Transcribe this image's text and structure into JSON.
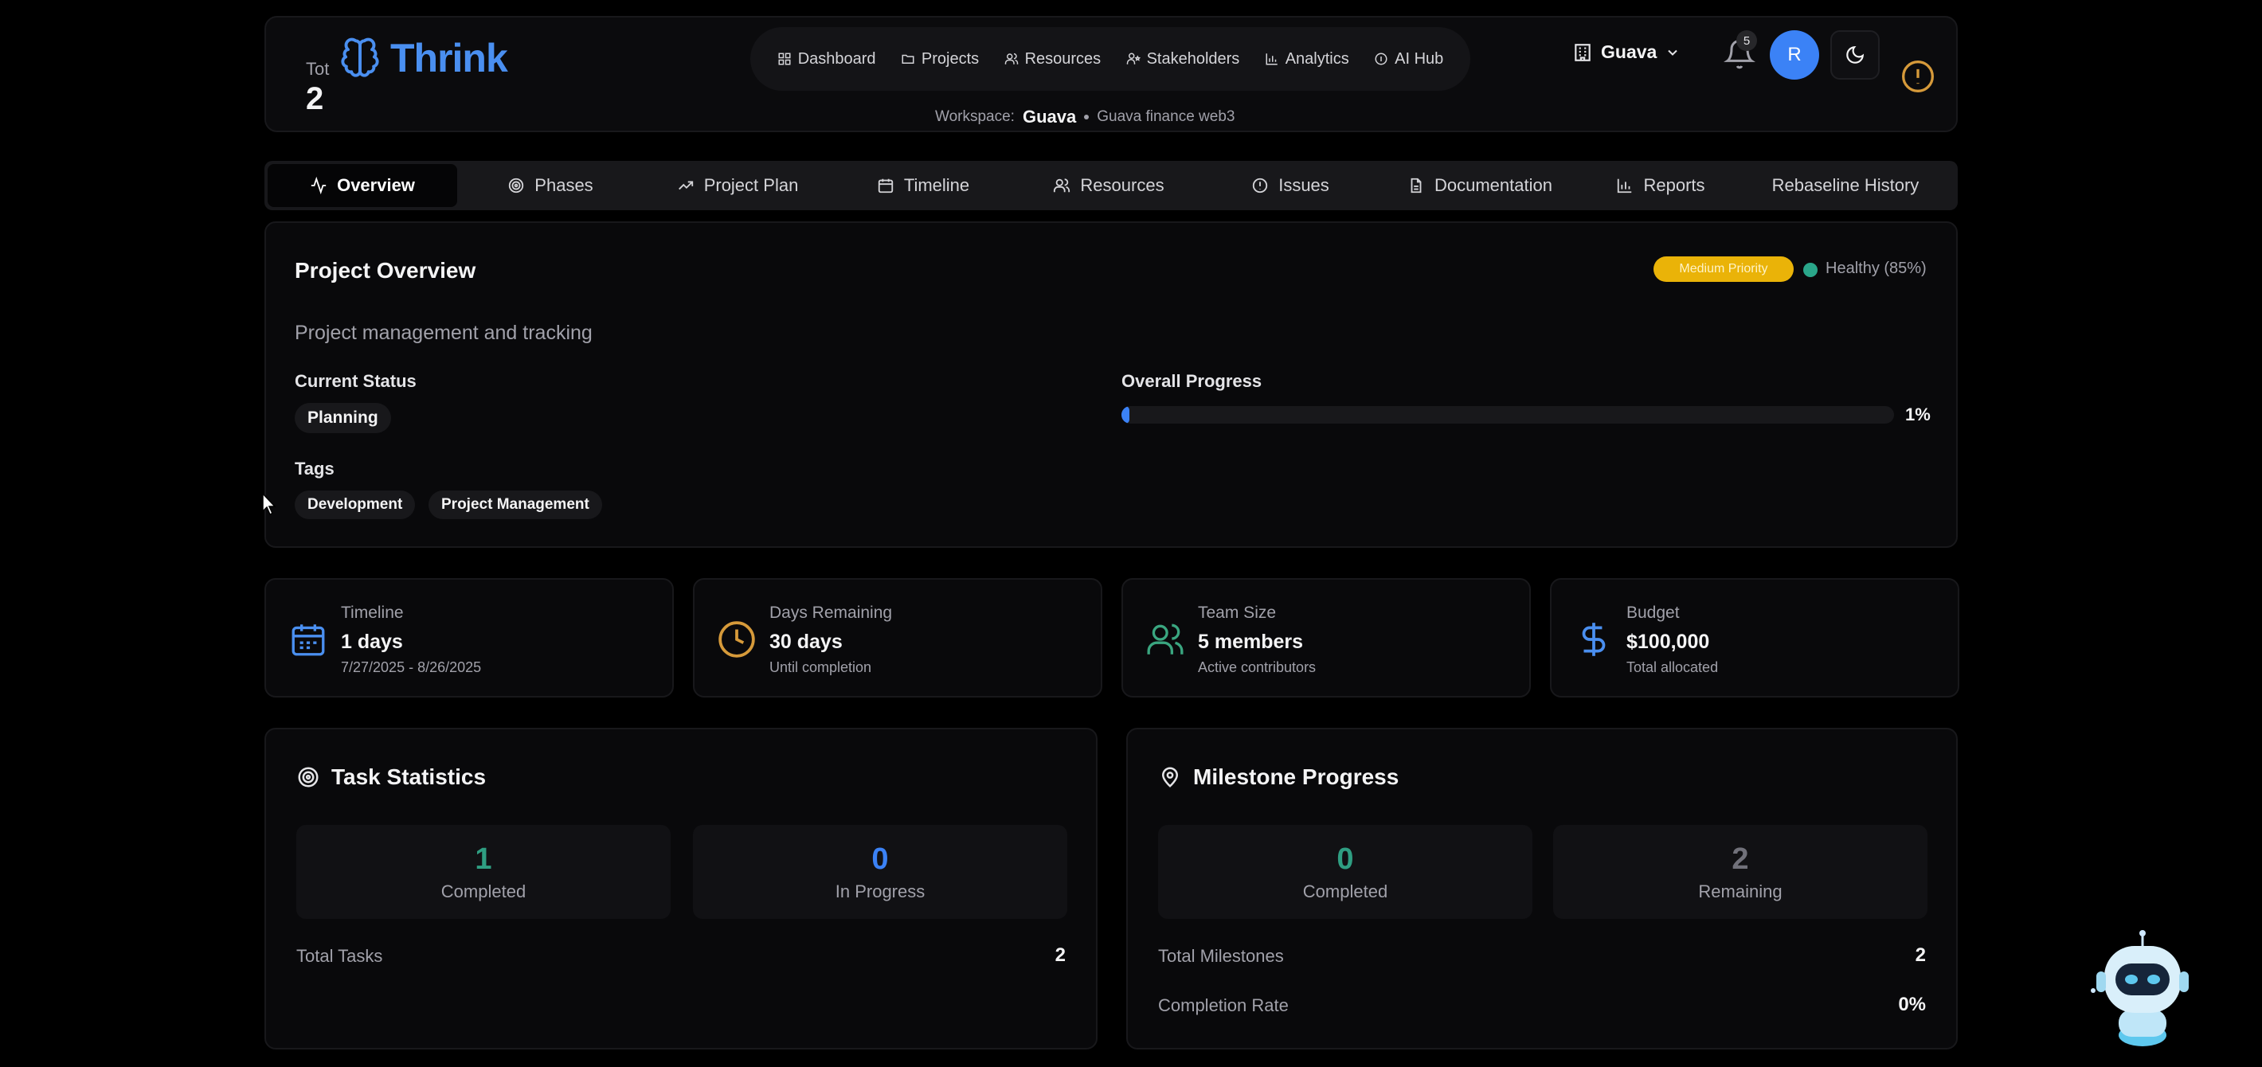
{
  "header": {
    "total_label": "Tot",
    "total_value": "2",
    "brand": "Thrink",
    "nav": [
      {
        "label": "Dashboard",
        "icon": "grid-icon"
      },
      {
        "label": "Projects",
        "icon": "folder-icon"
      },
      {
        "label": "Resources",
        "icon": "users-icon"
      },
      {
        "label": "Stakeholders",
        "icon": "user-star-icon"
      },
      {
        "label": "Analytics",
        "icon": "bar-chart-icon"
      },
      {
        "label": "AI Hub",
        "icon": "info-circle-icon"
      }
    ],
    "workspace_prefix": "Workspace:",
    "workspace_name": "Guava",
    "workspace_project": "Guava finance web3",
    "workspace_select": "Guava",
    "notification_count": "5",
    "avatar_initial": "R"
  },
  "tabs": [
    {
      "label": "Overview",
      "icon": "activity-icon",
      "active": true
    },
    {
      "label": "Phases",
      "icon": "target-icon"
    },
    {
      "label": "Project Plan",
      "icon": "trending-up-icon"
    },
    {
      "label": "Timeline",
      "icon": "calendar-icon"
    },
    {
      "label": "Resources",
      "icon": "users-icon"
    },
    {
      "label": "Issues",
      "icon": "alert-circle-icon"
    },
    {
      "label": "Documentation",
      "icon": "file-icon"
    },
    {
      "label": "Reports",
      "icon": "bar-chart-icon"
    },
    {
      "label": "Rebaseline History",
      "icon": ""
    }
  ],
  "overview": {
    "title": "Project Overview",
    "priority": "Medium Priority",
    "health": "Healthy (85%)",
    "description": "Project management and tracking",
    "status_label": "Current Status",
    "status": "Planning",
    "tags_label": "Tags",
    "tags": [
      "Development",
      "Project Management"
    ],
    "progress_label": "Overall Progress",
    "progress_percent": 1,
    "progress_text": "1%"
  },
  "stats": [
    {
      "label": "Timeline",
      "value": "1 days",
      "sub": "7/27/2025 - 8/26/2025",
      "icon": "calendar-icon",
      "color": "#4a8ff0"
    },
    {
      "label": "Days Remaining",
      "value": "30 days",
      "sub": "Until completion",
      "icon": "clock-icon",
      "color": "#d69a3a"
    },
    {
      "label": "Team Size",
      "value": "5 members",
      "sub": "Active contributors",
      "icon": "users-icon",
      "color": "#3aa680"
    },
    {
      "label": "Budget",
      "value": "$100,000",
      "sub": "Total allocated",
      "icon": "dollar-icon",
      "color": "#4a8ff0"
    }
  ],
  "tasks": {
    "title": "Task Statistics",
    "completed_value": "1",
    "completed_label": "Completed",
    "in_progress_value": "0",
    "in_progress_label": "In Progress",
    "total_label": "Total Tasks",
    "total_value": "2"
  },
  "milestones": {
    "title": "Milestone Progress",
    "completed_value": "0",
    "completed_label": "Completed",
    "remaining_value": "2",
    "remaining_label": "Remaining",
    "total_label": "Total Milestones",
    "total_value": "2",
    "rate_label": "Completion Rate",
    "rate_value": "0%"
  },
  "colors": {
    "brand": "#4a8ff0",
    "green": "#2f9e82",
    "blue": "#3b82f6",
    "yellow": "#eab308"
  }
}
